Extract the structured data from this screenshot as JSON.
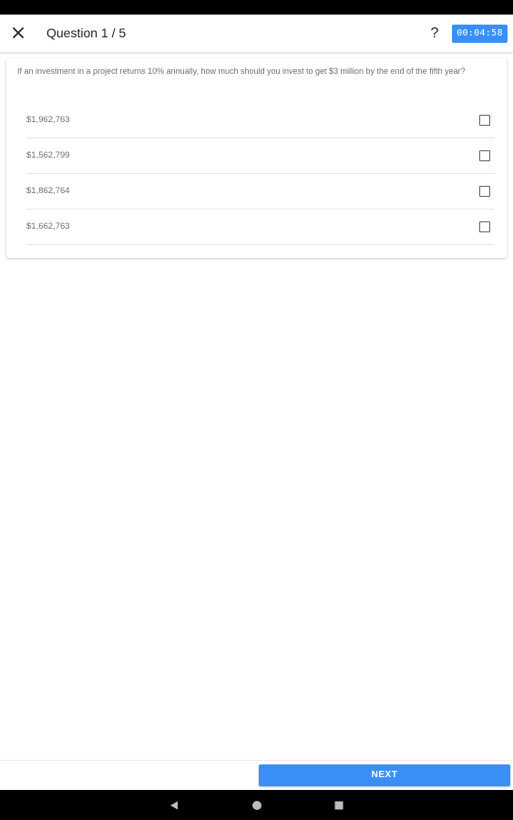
{
  "app_bar": {
    "title": "Question 1 / 5",
    "help_label": "?",
    "timer": "00:04:58",
    "icons": {
      "close": "close-icon"
    }
  },
  "question": {
    "text": "If an investment in a project returns 10% annually, how much should you invest to get $3 million by the end of the fifth year?",
    "options": [
      {
        "label": "$1,962,763",
        "checked": false
      },
      {
        "label": "$1,562,799",
        "checked": false
      },
      {
        "label": "$1,862,764",
        "checked": false
      },
      {
        "label": "$1,662,763",
        "checked": false
      }
    ]
  },
  "footer": {
    "next_label": "NEXT"
  },
  "colors": {
    "accent": "#3a8ff7",
    "text_muted": "#6e6e6e",
    "divider": "#e4e4e4"
  },
  "system_nav": {
    "icons": [
      "back-icon",
      "home-icon",
      "recents-icon"
    ]
  }
}
